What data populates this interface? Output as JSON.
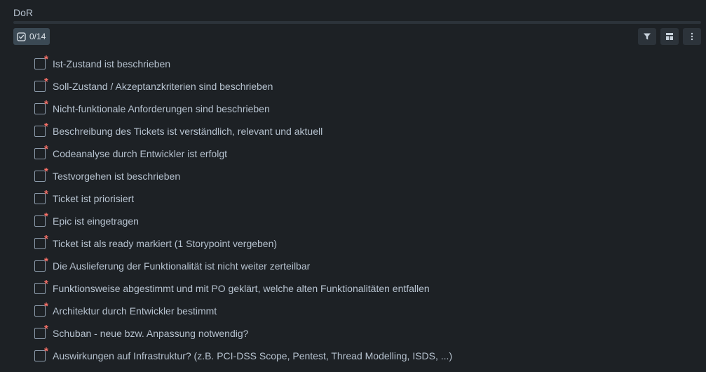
{
  "checklist": {
    "title": "DoR",
    "count_label": "0/14",
    "progress_fraction": 0,
    "required_marker": "*",
    "items": [
      {
        "label": "Ist-Zustand ist beschrieben",
        "checked": false
      },
      {
        "label": "Soll-Zustand / Akzeptanzkriterien sind beschrieben",
        "checked": false
      },
      {
        "label": "Nicht-funktionale Anforderungen sind beschrieben",
        "checked": false
      },
      {
        "label": "Beschreibung des Tickets ist verständlich, relevant und aktuell",
        "checked": false
      },
      {
        "label": "Codeanalyse durch Entwickler ist erfolgt",
        "checked": false
      },
      {
        "label": "Testvorgehen ist beschrieben",
        "checked": false
      },
      {
        "label": "Ticket ist priorisiert",
        "checked": false
      },
      {
        "label": "Epic ist eingetragen",
        "checked": false
      },
      {
        "label": "Ticket ist als ready markiert (1 Storypoint vergeben)",
        "checked": false
      },
      {
        "label": "Die Auslieferung der Funktionalität ist nicht weiter zerteilbar",
        "checked": false
      },
      {
        "label": "Funktionsweise abgestimmt und mit PO geklärt, welche alten Funktionalitäten entfallen",
        "checked": false
      },
      {
        "label": "Architektur durch Entwickler bestimmt",
        "checked": false
      },
      {
        "label": "Schuban - neue bzw. Anpassung notwendig?",
        "checked": false
      },
      {
        "label": "Auswirkungen auf Infrastruktur? (z.B. PCI-DSS Scope, Pentest, Thread Modelling, ISDS, ...)",
        "checked": false
      }
    ]
  },
  "toolbar": {
    "icons": [
      "filter-icon",
      "layout-icon",
      "more-vertical-icon"
    ]
  },
  "colors": {
    "background": "#1d2125",
    "text": "#b6c2cf",
    "required": "#f87168",
    "badge": "#3b4954",
    "button": "#2c333a"
  }
}
